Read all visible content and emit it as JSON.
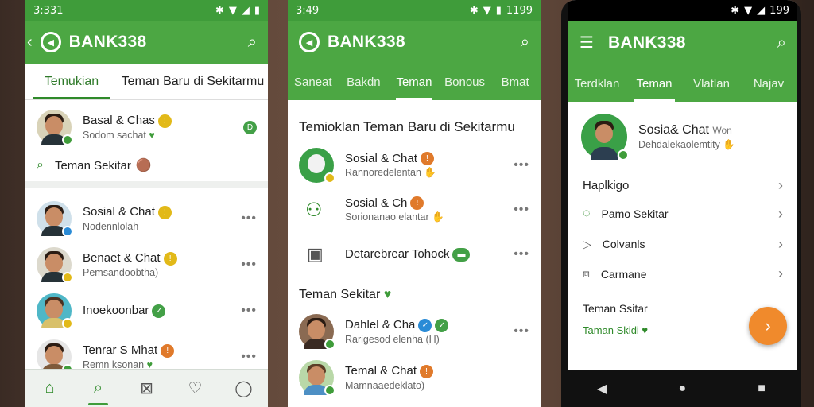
{
  "phone1": {
    "status_time": "3:331",
    "title": "BANK338",
    "tabs": [
      "Temukian",
      "Teman Baru di Sekitarmu"
    ],
    "card": {
      "name": "Basal & Chas",
      "sub": "Sodom sachat",
      "link": "Teman Sekitar"
    },
    "list": [
      {
        "name": "Sosial & Chat",
        "sub": "Nodennlolah"
      },
      {
        "name": "Benaet & Chat",
        "sub": "Pemsandoobtha)"
      },
      {
        "name": "Inoekoonbar",
        "sub": ""
      },
      {
        "name": "Tenrar S Mhat",
        "sub": "Remn ksonan"
      }
    ],
    "nav_icons": [
      "home-icon",
      "search-icon",
      "inbox-icon",
      "heart-mail-icon",
      "profile-icon"
    ]
  },
  "phone2": {
    "status_time": "3:49",
    "status_right": "1199",
    "title": "BANK338",
    "tabs": [
      "Saneat",
      "Bakdn",
      "Teman",
      "Bonous",
      "Bmat"
    ],
    "section1": "Temioklan Teman Baru di Sekitarmu",
    "rows1": [
      {
        "name": "Sosial & Chat",
        "sub": "Rannoredelentan"
      },
      {
        "name": "Sosial & Ch",
        "sub": "Sorionanao elantar"
      },
      {
        "name": "Detarebrear Tohock",
        "sub": ""
      }
    ],
    "section2": "Teman Sekitar",
    "rows2": [
      {
        "name": "Dahlel & Cha",
        "sub": "Rarigesod elenha (H)"
      },
      {
        "name": "Temal & Chat",
        "sub": "Mamnaaedeklato)"
      }
    ]
  },
  "phone3": {
    "status_right": "199",
    "title": "BANK338",
    "tabs": [
      "Terdklan",
      "Teman",
      "Vlatlan",
      "Najav"
    ],
    "profile": {
      "name": "Sosia& Chat",
      "name_tag": "Won",
      "sub": "Dehdalekaolemtity"
    },
    "menu_header": "Haplkigo",
    "menu": [
      "Pamo Sekitar",
      "Colvanls",
      "Carmane"
    ],
    "footer_title": "Teman Ssitar",
    "footer_link": "Taman Skidi"
  }
}
